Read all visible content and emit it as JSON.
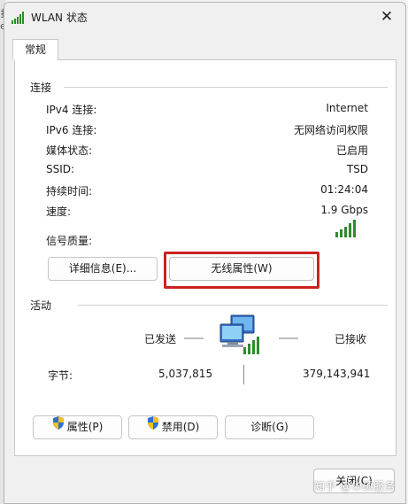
{
  "window": {
    "title": "WLAN 状态",
    "close_icon": "close-icon"
  },
  "tabs": [
    {
      "label": "常规"
    }
  ],
  "connection": {
    "group_label": "连接",
    "rows": [
      {
        "label": "IPv4 连接:",
        "value": "Internet"
      },
      {
        "label": "IPv6 连接:",
        "value": "无网络访问权限"
      },
      {
        "label": "媒体状态:",
        "value": "已启用"
      },
      {
        "label": "SSID:",
        "value": "TSD"
      },
      {
        "label": "持续时间:",
        "value": "01:24:04"
      },
      {
        "label": "速度:",
        "value": "1.9 Gbps"
      }
    ],
    "signal_label": "信号质量:",
    "signal_bars": 5,
    "details_button": "详细信息(E)...",
    "wireless_props_button": "无线属性(W)"
  },
  "activity": {
    "group_label": "活动",
    "sent_label": "已发送",
    "received_label": "已接收",
    "bytes_label": "字节:",
    "bytes_sent": "5,037,815",
    "bytes_received": "379,143,941"
  },
  "buttons": {
    "properties": "属性(P)",
    "disable": "禁用(D)",
    "diagnose": "诊断(G)"
  },
  "footer": {
    "close": "关闭(C)"
  },
  "watermark": "知乎 @华硕服务",
  "colors": {
    "highlight": "#cc2222",
    "signal_green": "#2e8b2e"
  }
}
